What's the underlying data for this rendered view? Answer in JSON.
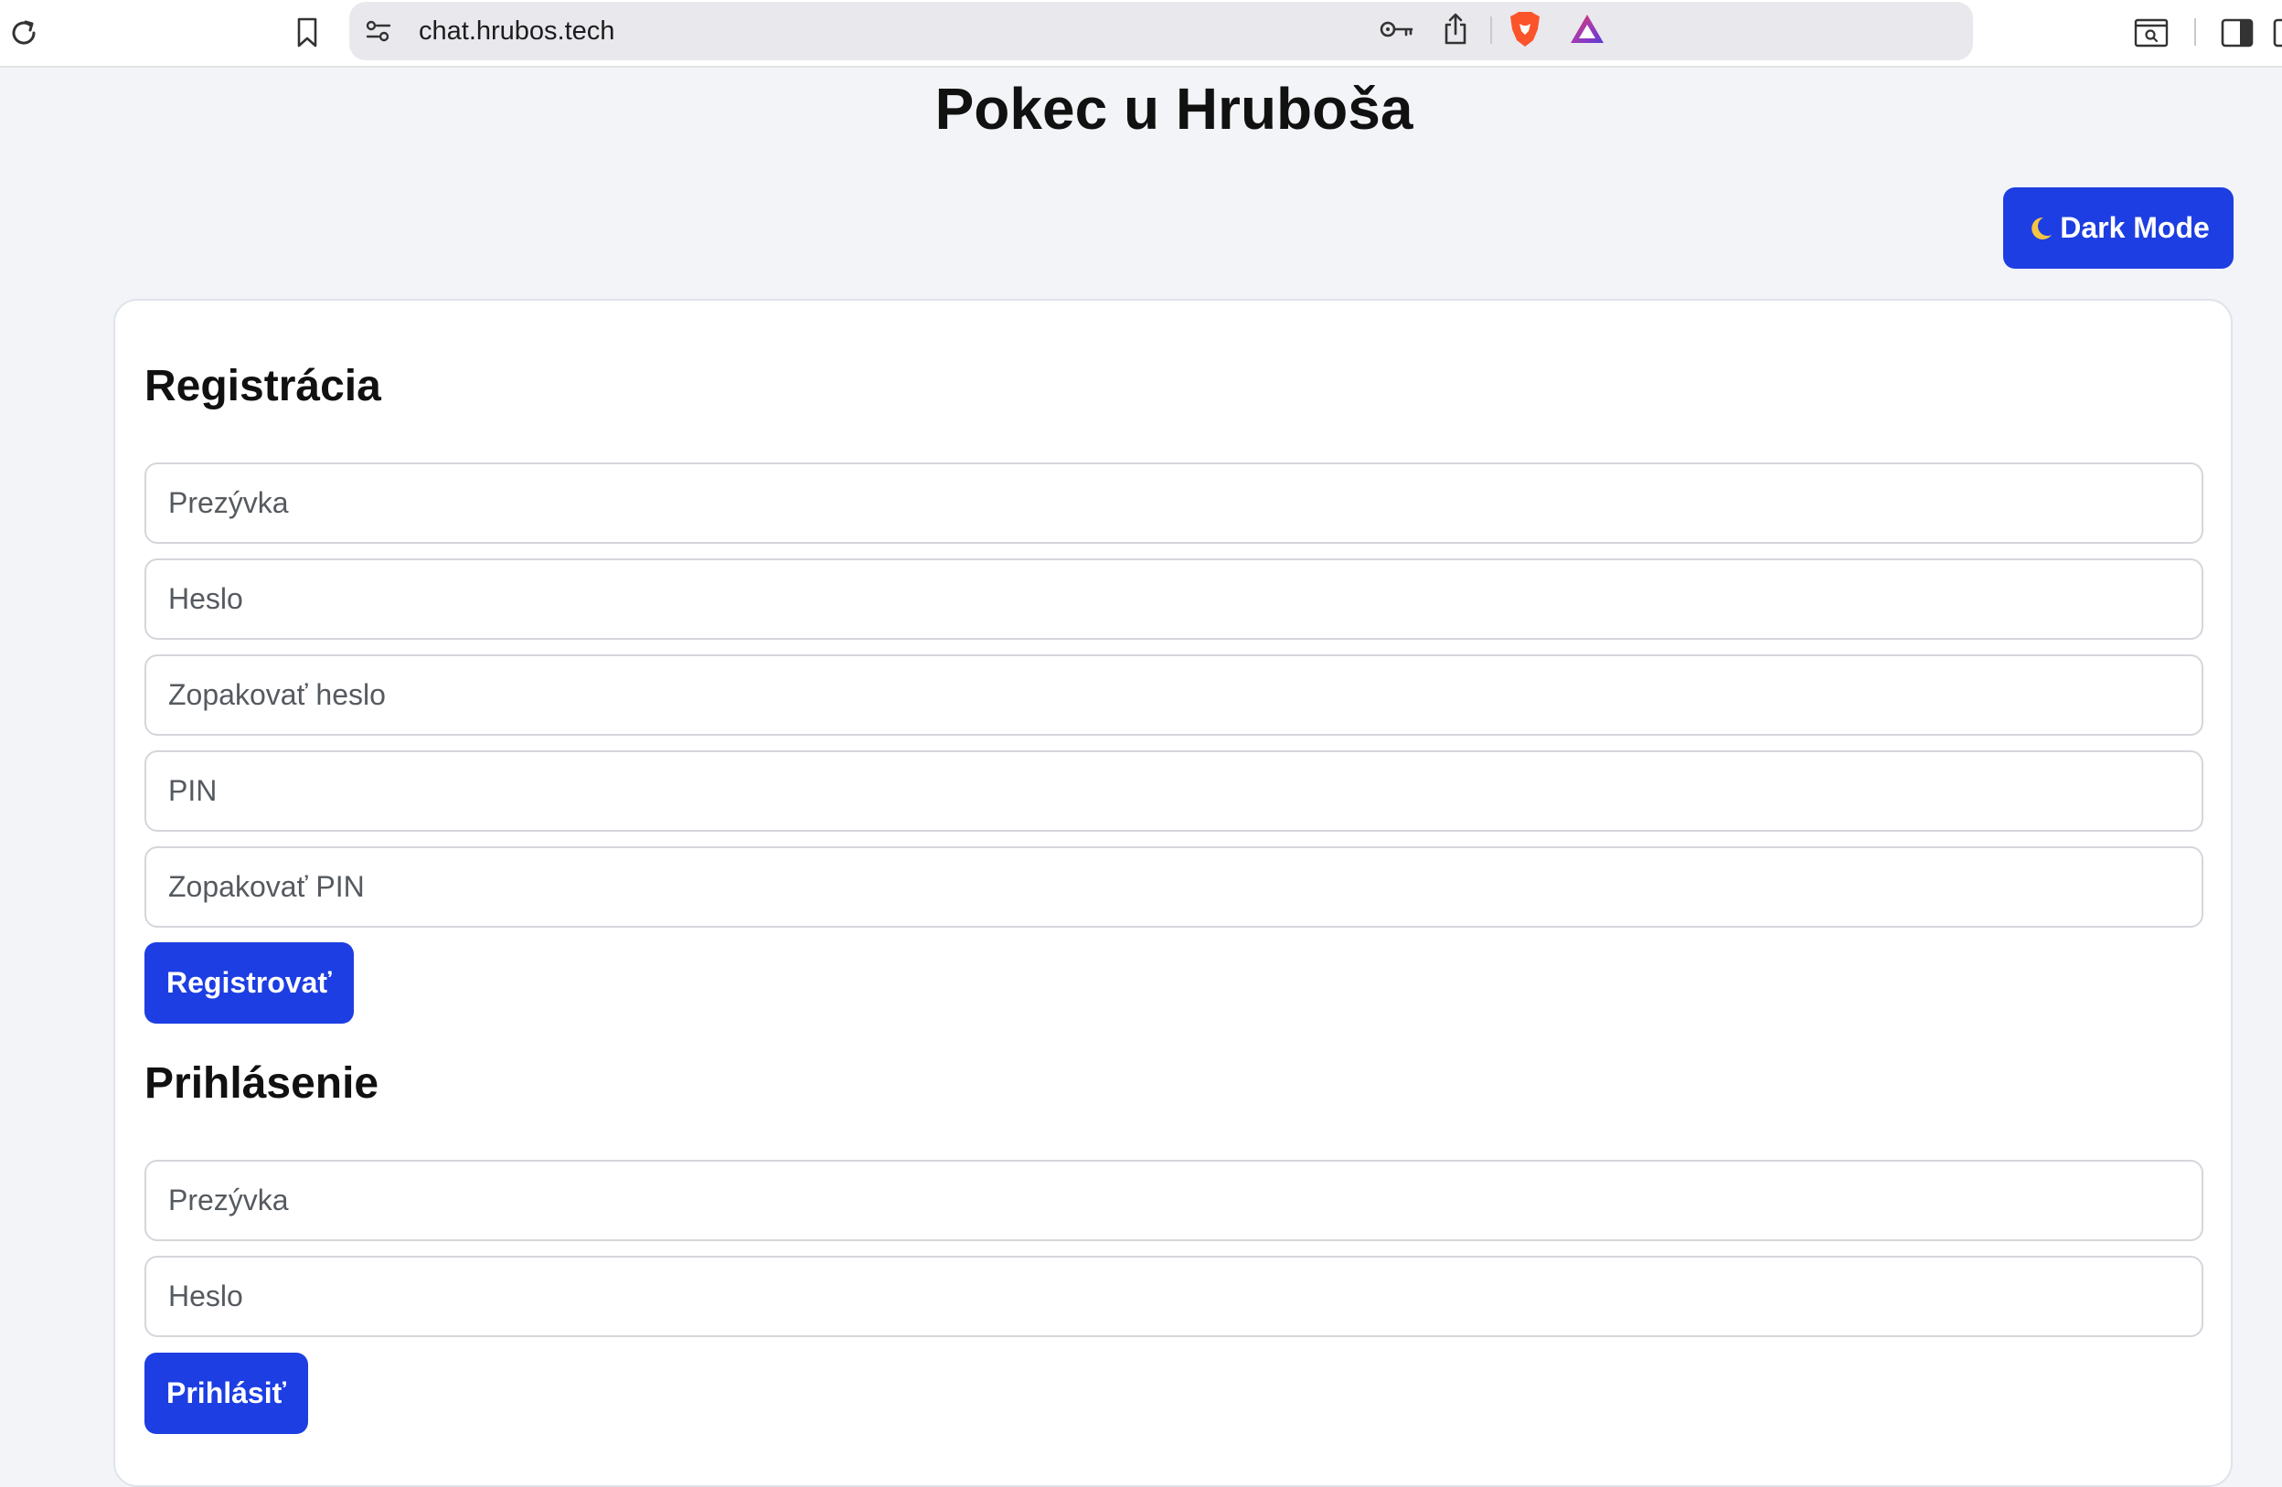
{
  "browser": {
    "url": "chat.hrubos.tech",
    "icons": {
      "reload": "reload-icon",
      "bookmark": "bookmark-icon",
      "site_settings": "site-settings-icon",
      "password": "key-icon",
      "share": "share-icon",
      "brave_shields": "brave-lion-icon",
      "rewards": "brave-rewards-triangle-icon",
      "reader": "reader-mode-icon",
      "sidebar": "sidebar-toggle-icon"
    }
  },
  "page": {
    "title": "Pokec u Hruboša",
    "dark_mode_label": "Dark Mode",
    "dark_mode_icon": "moon-icon"
  },
  "register": {
    "heading": "Registrácia",
    "nickname_placeholder": "Prezývka",
    "password_placeholder": "Heslo",
    "password_repeat_placeholder": "Zopakovať heslo",
    "pin_placeholder": "PIN",
    "pin_repeat_placeholder": "Zopakovať PIN",
    "submit_label": "Registrovať"
  },
  "login": {
    "heading": "Prihlásenie",
    "nickname_placeholder": "Prezývka",
    "password_placeholder": "Heslo",
    "submit_label": "Prihlásiť"
  },
  "colors": {
    "accent": "#1d3ee2",
    "background": "#f2f4f8",
    "card": "#ffffff",
    "brave_orange": "#fb542b"
  }
}
